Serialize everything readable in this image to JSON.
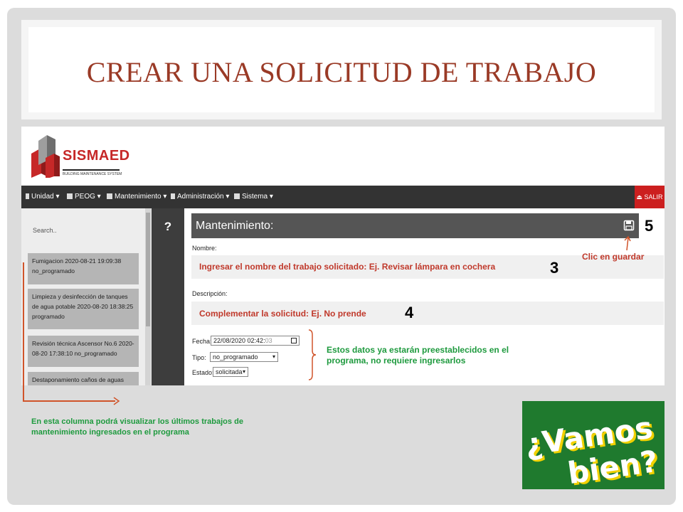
{
  "slide": {
    "title": "CREAR UNA SOLICITUD DE TRABAJO"
  },
  "app": {
    "logo_text": "SISMAED",
    "logo_subtitle": "BUILDING MAINTENANCE SYSTEM",
    "nav": {
      "items": [
        "Unidad",
        "PEOG",
        "Mantenimiento",
        "Administración",
        "Sistema"
      ],
      "salir": "SALIR"
    },
    "sidebar": {
      "search_placeholder": "Search..",
      "items": [
        "Fumigacion 2020-08-21 19:09:38 no_programado",
        "Limpieza y desinfección de tanques de agua potable 2020-08-20 18:38:25 programado",
        "Revisión técnica Ascensor No.6 2020-08-20 17:38:10 no_programado",
        "Destaponamiento caños de aguas"
      ]
    },
    "help_label": "?",
    "form": {
      "header": "Mantenimiento:",
      "nombre_label": "Nombre:",
      "descripcion_label": "Descripción:",
      "fecha_label": "Fecha:",
      "fecha_value": "22/08/2020 02:42:",
      "fecha_seconds": "03",
      "tipo_label": "Tipo:",
      "tipo_value": "no_programado",
      "estado_label": "Estado:",
      "estado_value": "solicitada"
    }
  },
  "annotations": {
    "nombre_hint": "Ingresar el nombre del trabajo solicitado: Ej. Revisar lámpara en cochera",
    "descripcion_hint": "Complementar  la solicitud: Ej. No prende",
    "guardar_hint": "Clic en guardar",
    "step_3": "3",
    "step_4": "4",
    "step_5": "5",
    "preset_note": "Estos datos ya estarán preestablecidos en el programa, no requiere ingresarlos",
    "column_note": "En esta columna podrá visualizar los últimos trabajos de mantenimiento ingresados en el programa"
  },
  "badge": {
    "line1": "¿Vamos",
    "line2": "bien?"
  },
  "colors": {
    "title": "#9a3a26",
    "brand_red": "#c62828",
    "navbar": "#333333",
    "hint_red": "#c0392b",
    "note_green": "#1e9a3e",
    "badge_bg": "#1f7a2e",
    "badge_text": "#ffffff",
    "badge_shadow": "#f2d100"
  }
}
